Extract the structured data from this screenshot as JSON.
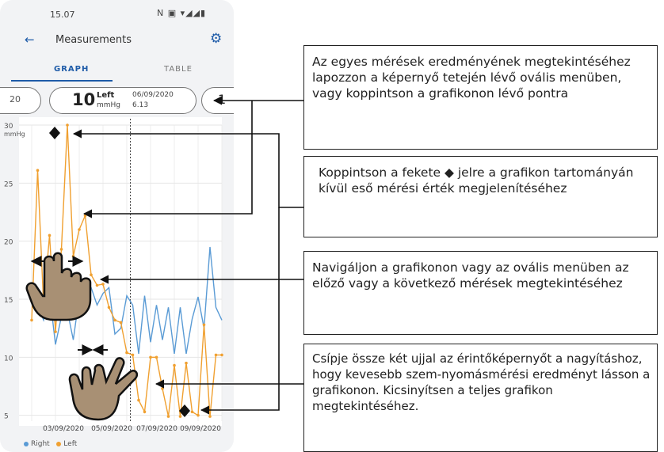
{
  "status_bar": {
    "time": "15.07",
    "icons": "N ▣ ▾◢◢▮"
  },
  "appbar": {
    "title": "Measurements",
    "back_icon": "arrow-left-icon",
    "settings_icon": "gear-icon"
  },
  "tabs": [
    {
      "label": "GRAPH",
      "active": true
    },
    {
      "label": "TABLE",
      "active": false
    }
  ],
  "pills": {
    "prev_value": "20",
    "current": {
      "value": "10",
      "side": "Left",
      "unit": "mmHg",
      "date": "06/09/2020",
      "time": "6.13"
    },
    "next_value": "1"
  },
  "legend": [
    {
      "label": "Right",
      "color": "#5a9bd5"
    },
    {
      "label": "Left",
      "color": "#f0a030"
    }
  ],
  "callouts": [
    "Az egyes mérések eredményének megtekintéséhez lapozzon a képernyő tetején lévő ovális menüben, vagy koppintson a grafikonon lévő pontra",
    "Koppintson a fekete ◆ jelre a grafikon tartományán kívül eső mérési érték megjelenítéséhez",
    "Navigáljon a grafikonon vagy az ovális menüben az előző vagy a következő mérések megtekintéséhez",
    "Csípje össze két ujjal az érintőképernyőt a nagyításhoz, hogy kevesebb szem-nyomásmérési eredményt lásson a grafikonon. Kicsinyítsen a teljes grafikon megtekintéséhez."
  ],
  "chart_data": {
    "type": "line",
    "ylabel": "mmHg",
    "ylim": [
      4.5,
      30
    ],
    "yticks": [
      5,
      10,
      15,
      20,
      25,
      30
    ],
    "x_tick_labels": [
      "03/09/2020",
      "05/09/2020",
      "07/09/2020",
      "09/09/2020"
    ],
    "out_of_range_markers": 2,
    "series": [
      {
        "name": "Right",
        "color": "#5a9bd5",
        "values": [
          15.5,
          14.5,
          13.2,
          15.5,
          11.1,
          13.5,
          14,
          11.5,
          15.2,
          15.8,
          16,
          14.5,
          15.5,
          16,
          12,
          12.5,
          15.3,
          14.5,
          10.3,
          15.3,
          11.3,
          14.5,
          11.5,
          14.3,
          10.3,
          14.3,
          10.3,
          13.3,
          15.2,
          12.5,
          19.5,
          14.3,
          13.2
        ]
      },
      {
        "name": "Left",
        "color": "#f0a030",
        "values": [
          13.2,
          26.1,
          14.5,
          20.5,
          12.2,
          19.3,
          30,
          18.7,
          21,
          22.2,
          17.1,
          16.2,
          16.3,
          14.3,
          13.2,
          13,
          10.4,
          10.2,
          6.3,
          5.3,
          10,
          10,
          7.3,
          4.9,
          9.3,
          4.9,
          9.5,
          5.3,
          5,
          12.8,
          4.9,
          10.2,
          10.2
        ]
      }
    ]
  }
}
